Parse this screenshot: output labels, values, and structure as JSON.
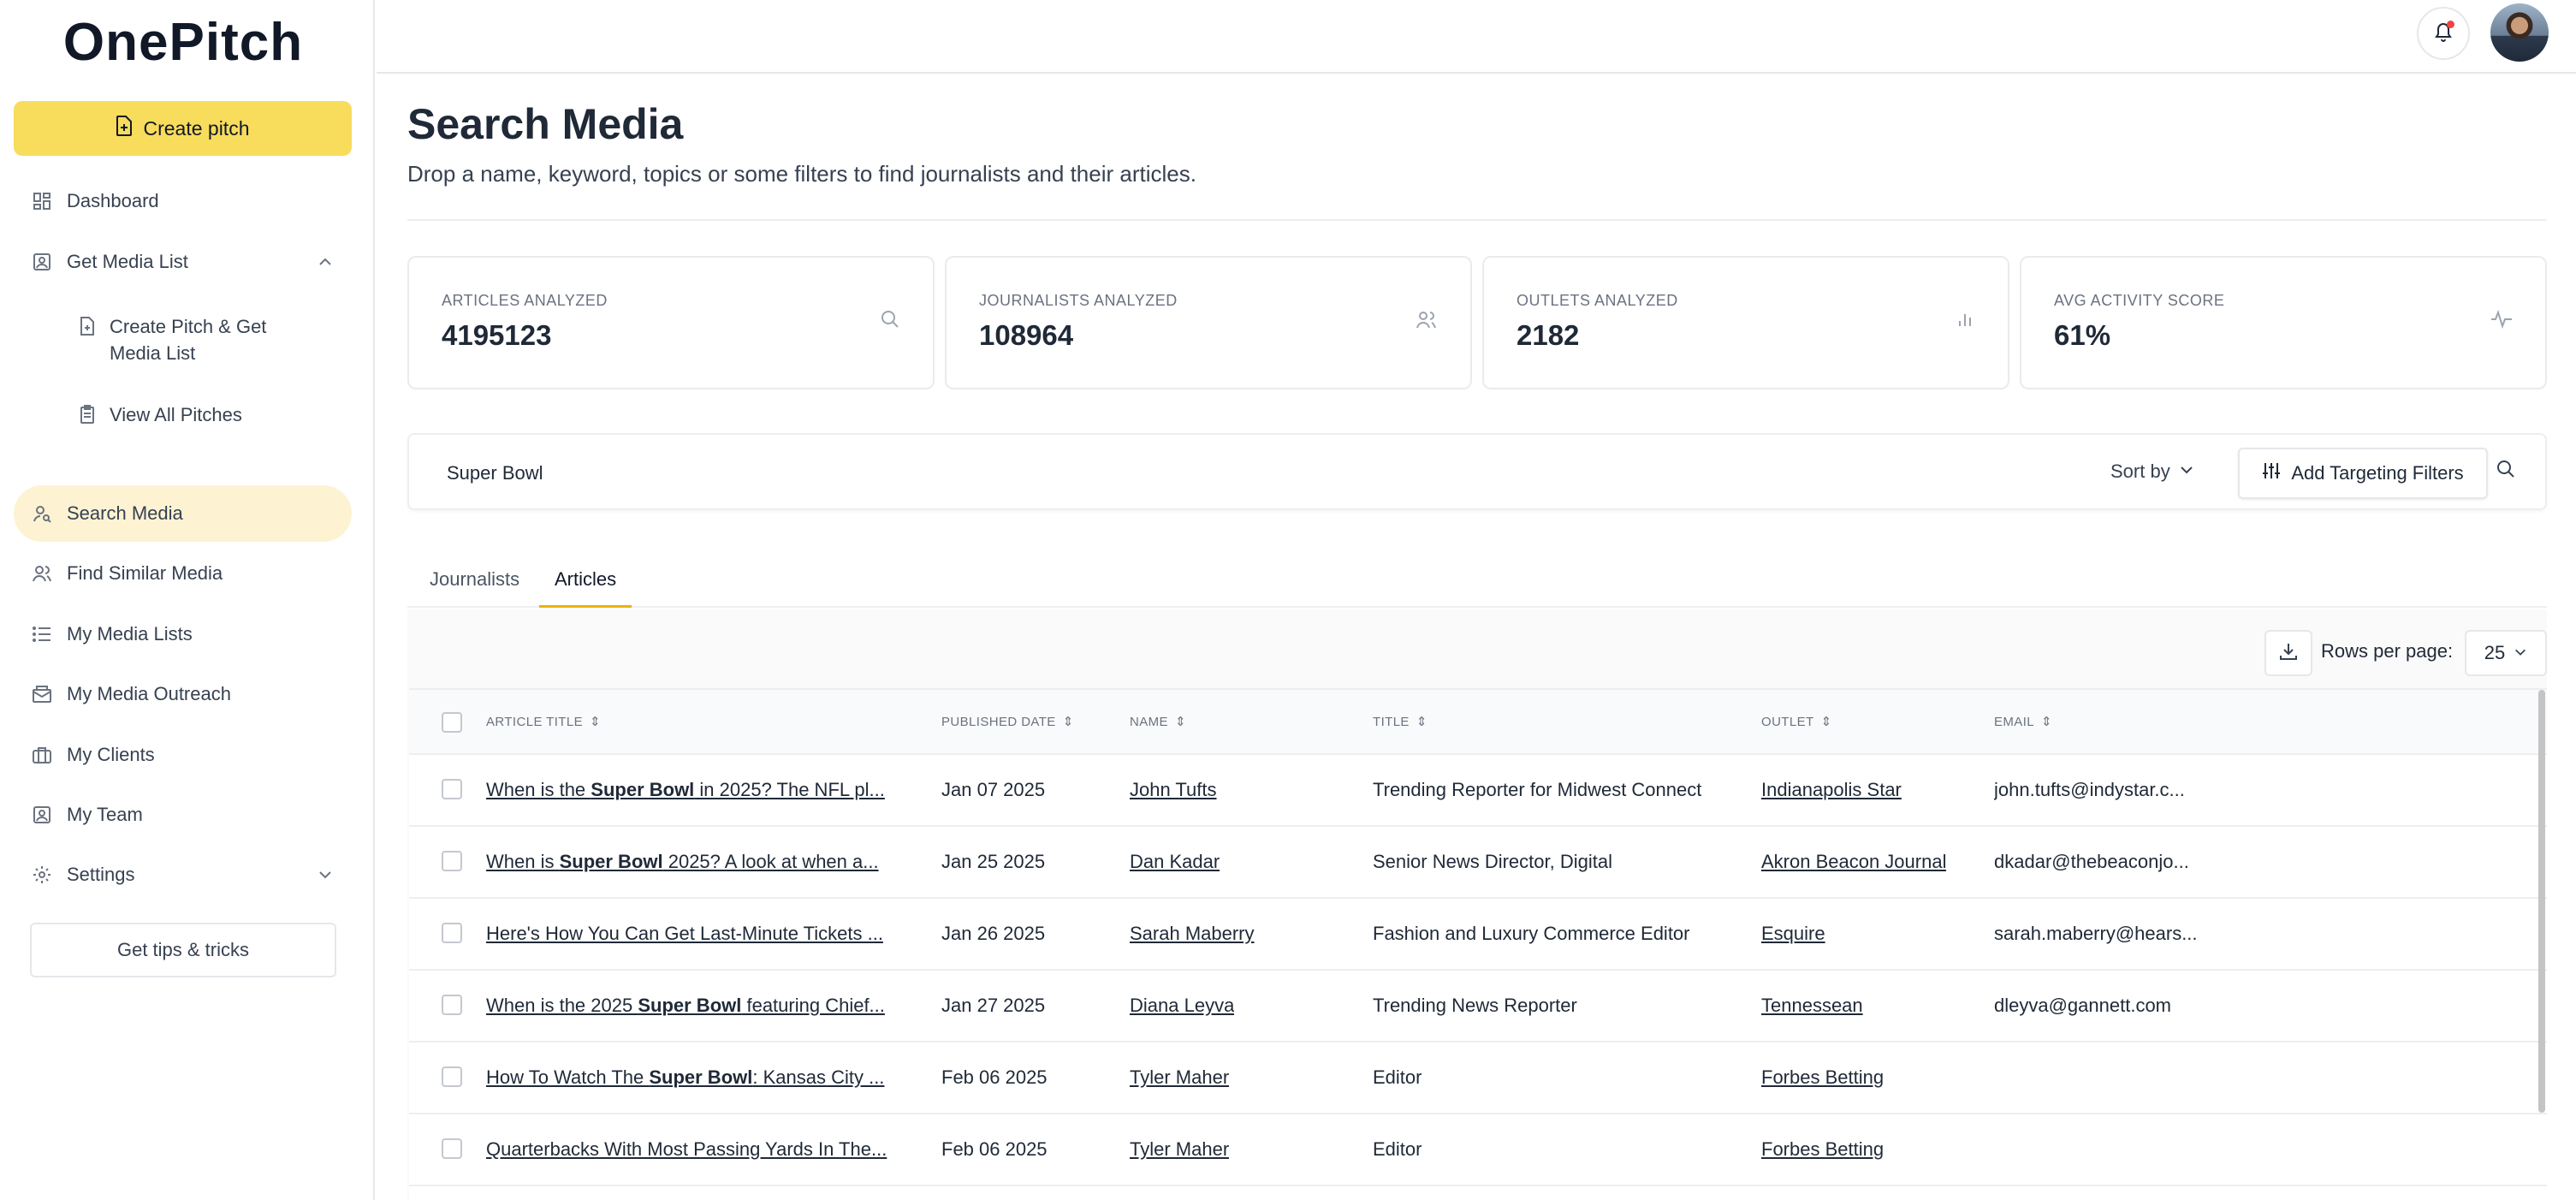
{
  "sidebar": {
    "logo": "OnePitch",
    "create_pitch": "Create pitch",
    "nav": [
      {
        "label": "Dashboard",
        "icon": "dashboard-icon"
      },
      {
        "label": "Get Media List",
        "icon": "media-list-icon"
      },
      {
        "label": "Search Media",
        "icon": "search-user-icon"
      },
      {
        "label": "Find Similar Media",
        "icon": "users-icon"
      },
      {
        "label": "My Media Lists",
        "icon": "list-icon"
      },
      {
        "label": "My Media Outreach",
        "icon": "outreach-icon"
      },
      {
        "label": "My Clients",
        "icon": "briefcase-icon"
      },
      {
        "label": "My Team",
        "icon": "team-icon"
      },
      {
        "label": "Settings",
        "icon": "gear-icon"
      }
    ],
    "sub_nav": [
      {
        "label": "Create Pitch & Get Media List",
        "icon": "document-plus-icon"
      },
      {
        "label": "View All Pitches",
        "icon": "clipboard-icon"
      }
    ],
    "tips": "Get tips & tricks"
  },
  "header": {
    "title": "Search Media",
    "subtitle": "Drop a name, keyword, topics or some filters to find journalists and their articles."
  },
  "stats": [
    {
      "label": "ARTICLES ANALYZED",
      "value": "4195123",
      "icon": "search-icon"
    },
    {
      "label": "JOURNALISTS ANALYZED",
      "value": "108964",
      "icon": "users-icon"
    },
    {
      "label": "OUTLETS ANALYZED",
      "value": "2182",
      "icon": "bar-chart-icon"
    },
    {
      "label": "AVG ACTIVITY SCORE",
      "value": "61%",
      "icon": "activity-icon"
    }
  ],
  "search": {
    "value": "Super Bowl",
    "sort_label": "Sort by",
    "filters_label": "Add Targeting Filters"
  },
  "tabs": [
    "Journalists",
    "Articles"
  ],
  "table": {
    "rows_per_page_label": "Rows per page:",
    "rows_per_page": "25",
    "columns": [
      "ARTICLE TITLE",
      "PUBLISHED DATE",
      "NAME",
      "TITLE",
      "OUTLET",
      "EMAIL"
    ],
    "rows": [
      {
        "t1": "When is the ",
        "t2": "Super Bowl",
        "t3": " in 2025? The NFL pl...",
        "date": "Jan 07 2025",
        "name": "John Tufts",
        "title": "Trending Reporter for Midwest Connect",
        "outlet": "Indianapolis Star",
        "email": "john.tufts@indystar.c..."
      },
      {
        "t1": "When is ",
        "t2": "Super Bowl",
        "t3": " 2025? A look at when a...",
        "date": "Jan 25 2025",
        "name": "Dan Kadar",
        "title": "Senior News Director, Digital",
        "outlet": "Akron Beacon Journal",
        "email": "dkadar@thebeaconjo..."
      },
      {
        "t1": "Here's How You Can Get Last-Minute Tickets ...",
        "t2": "",
        "t3": "",
        "date": "Jan 26 2025",
        "name": "Sarah Maberry",
        "title": "Fashion and Luxury Commerce Editor",
        "outlet": "Esquire",
        "email": "sarah.maberry@hears..."
      },
      {
        "t1": "When is the 2025 ",
        "t2": "Super Bowl",
        "t3": " featuring Chief...",
        "date": "Jan 27 2025",
        "name": "Diana Leyva",
        "title": "Trending News Reporter",
        "outlet": "Tennessean",
        "email": "dleyva@gannett.com"
      },
      {
        "t1": "How To Watch The ",
        "t2": "Super Bowl",
        "t3": ": Kansas City ...",
        "date": "Feb 06 2025",
        "name": "Tyler Maher",
        "title": "Editor",
        "outlet": "Forbes Betting",
        "email": ""
      },
      {
        "t1": "Quarterbacks With Most Passing Yards In The...",
        "t2": "",
        "t3": "",
        "date": "Feb 06 2025",
        "name": "Tyler Maher",
        "title": "Editor",
        "outlet": "Forbes Betting",
        "email": ""
      }
    ]
  },
  "colors": {
    "accent": "#f8dc5c",
    "active_nav": "#fdf3d2",
    "tab_underline": "#eab308"
  }
}
